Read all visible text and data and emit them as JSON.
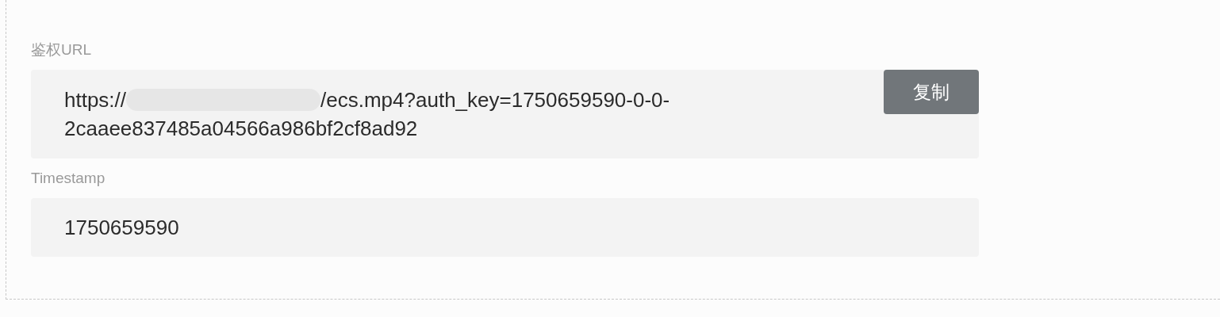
{
  "fields": [
    {
      "kind": "url",
      "label": "鉴权URL",
      "value_start": "https://",
      "value_end": "/ecs.mp4?auth_key=1750659590-0-0-",
      "value_line2": "2caaee837485a04566a986bf2cf8ad92",
      "redacted": true,
      "button": "复制"
    },
    {
      "kind": "plain",
      "label": "Timestamp",
      "value_start": "1750659590"
    }
  ]
}
